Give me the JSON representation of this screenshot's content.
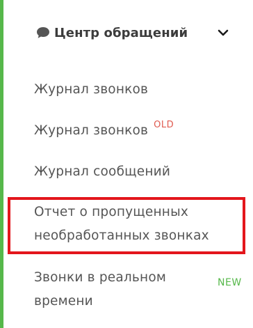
{
  "section": {
    "title": "Центр обращений",
    "icon": "chat-bubble-icon",
    "expand_icon": "chevron-down-icon"
  },
  "menu": {
    "items": [
      {
        "label": "Журнал звонков"
      },
      {
        "label": "Журнал звонков",
        "badge": "OLD"
      },
      {
        "label": "Журнал сообщений"
      },
      {
        "line1": "Отчет о пропущенных",
        "line2": "необработанных звонках",
        "highlighted": true
      },
      {
        "line1": "Звонки в реальном",
        "line2": "времени",
        "badge": "NEW"
      }
    ]
  },
  "colors": {
    "accent": "#56b84a",
    "text": "#555555",
    "badge_old": "#e05a4f",
    "badge_new": "#56b84a",
    "highlight": "#e3161c"
  }
}
